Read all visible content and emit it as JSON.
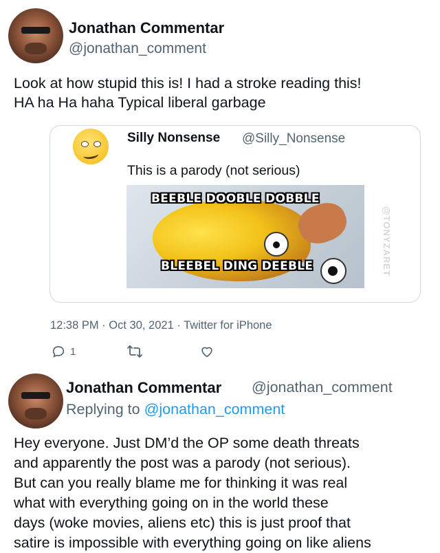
{
  "main_tweet": {
    "author_name": "Jonathan Commentar",
    "author_handle": "@jonathan_comment",
    "text_lines": [
      "Look at how stupid this is! I had a stroke reading this!",
      "HA ha Ha haha Typical liberal garbage"
    ],
    "timestamp": "12:38 PM · Oct 30, 2021 · Twitter for iPhone",
    "reply_count": "1"
  },
  "quoted_tweet": {
    "author_name": "Silly Nonsense",
    "author_handle": "@Silly_Nonsense",
    "text": "This is a parody (not serious)",
    "meme_caption_top": "BEEBLE DOOBLE DOBBLE",
    "meme_caption_bottom": "BLEEBEL DING DEEBLE",
    "watermark": "@TONYZARET"
  },
  "reply_tweet": {
    "author_name": "Jonathan Commentar",
    "author_handle": "@jonathan_comment",
    "replying_prefix": "Replying to",
    "replying_handle": "@jonathan_comment",
    "text_lines": [
      "Hey everyone. Just DM’d the OP some death threats",
      "and apparently the post was a parody (not serious).",
      "But can you really blame me for thinking it was real",
      "what with everything going on in the world these",
      "days (woke movies, aliens etc) this is just proof that",
      "satire is impossible with everything going on like aliens"
    ]
  },
  "icons": {
    "reply": "reply-icon",
    "retweet": "retweet-icon",
    "like": "heart-icon"
  },
  "colors": {
    "link_blue": "#1d9bf0",
    "secondary_text": "#536471",
    "card_border": "#cfd9de"
  }
}
